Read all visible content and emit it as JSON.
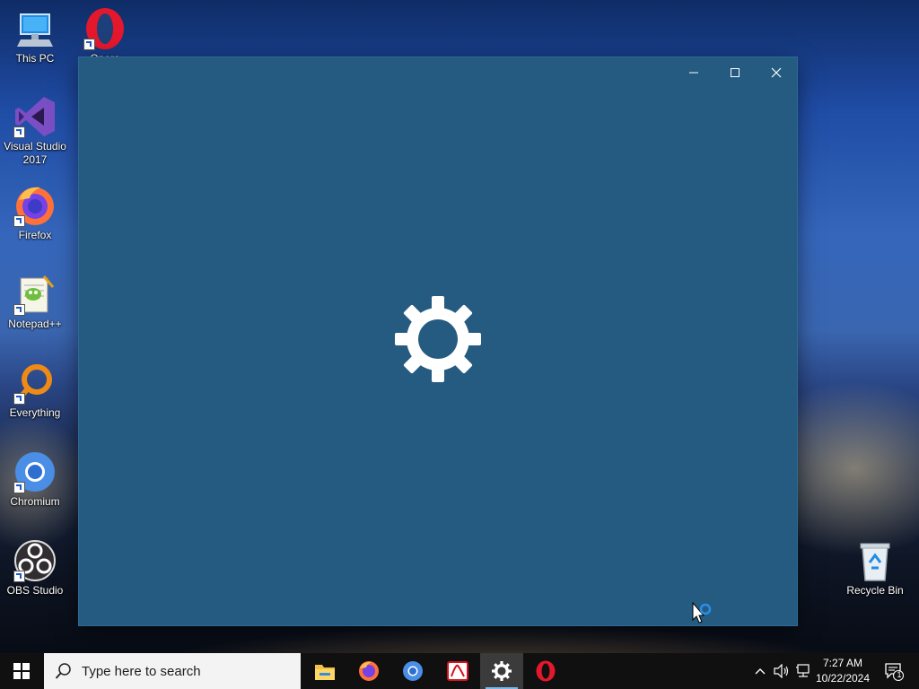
{
  "desktop": {
    "icons": [
      {
        "label": "This PC"
      },
      {
        "label": "Opera"
      },
      {
        "label": "Visual Studio 2017"
      },
      {
        "label": "Firefox"
      },
      {
        "label": "Notepad++"
      },
      {
        "label": "Everything"
      },
      {
        "label": "Chromium"
      },
      {
        "label": "OBS Studio"
      },
      {
        "label": "Recycle Bin"
      }
    ]
  },
  "window": {
    "background_color": "#255b80",
    "splash_icon": "gear-icon",
    "controls": [
      "minimize-icon",
      "maximize-icon",
      "close-icon"
    ]
  },
  "taskbar": {
    "search_placeholder": "Type here to search",
    "pinned": [
      {
        "name": "File Explorer",
        "running": false
      },
      {
        "name": "Firefox",
        "running": false
      },
      {
        "name": "Chromium",
        "running": false
      },
      {
        "name": "Adobe Acrobat Reader",
        "running": false
      },
      {
        "name": "Settings",
        "running": true,
        "active": true
      },
      {
        "name": "Opera",
        "running": false
      }
    ],
    "clock": {
      "time": "7:27 AM",
      "date": "10/22/2024"
    },
    "notifications_count": "1"
  }
}
